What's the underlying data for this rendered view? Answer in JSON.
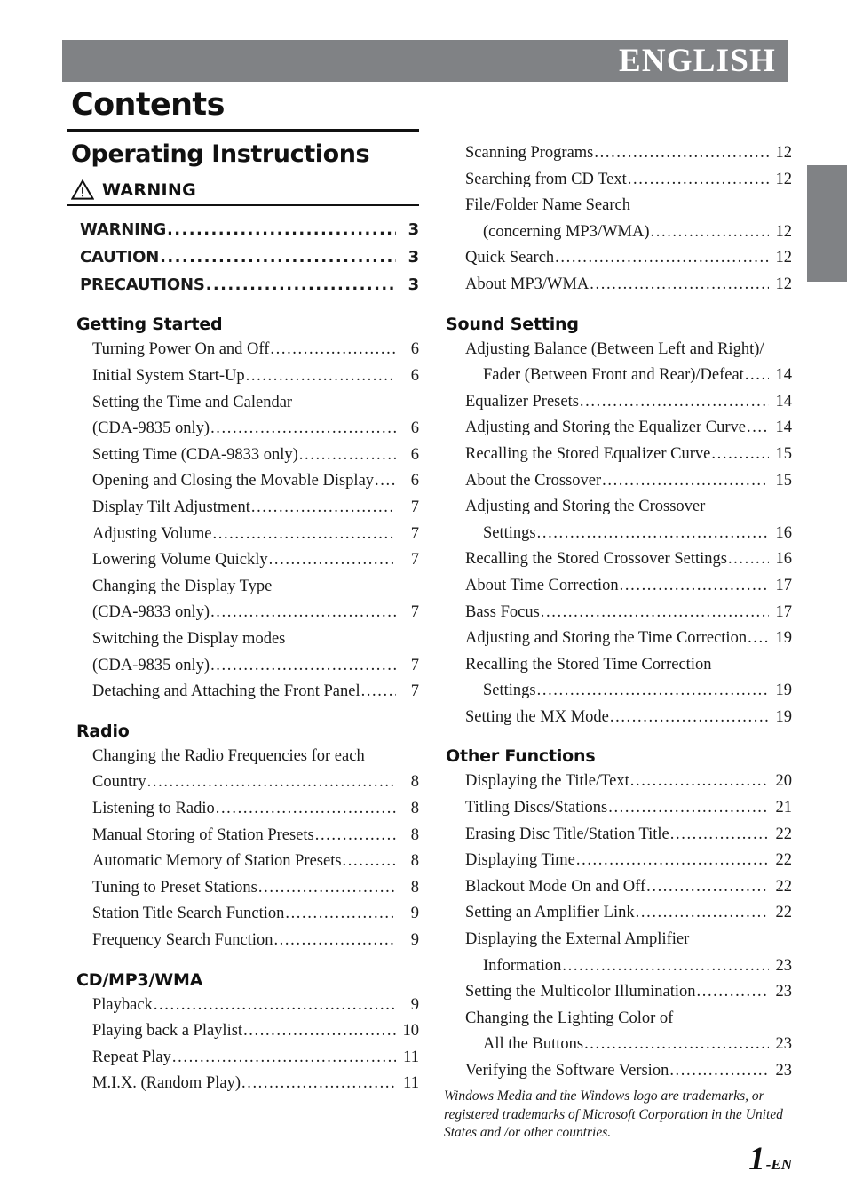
{
  "banner": {
    "language_label": "ENGLISH",
    "background_color": "#808285",
    "text_color": "#ffffff"
  },
  "side_tab": {
    "color": "#808285"
  },
  "header": {
    "page_title": "Contents",
    "document_subtitle": "Operating Instructions",
    "warning_heading": "WARNING",
    "warning_icon": "warning-triangle-icon"
  },
  "left_column": {
    "warning_block": {
      "entries": [
        {
          "label": "WARNING",
          "page": "3"
        },
        {
          "label": "CAUTION",
          "page": "3"
        },
        {
          "label": "PRECAUTIONS",
          "page": "3"
        }
      ]
    },
    "sections": [
      {
        "heading": "Getting Started",
        "entries": [
          {
            "label": "Turning Power On and Off",
            "page": "6"
          },
          {
            "label": "Initial System Start-Up",
            "page": "6"
          },
          {
            "label": "Setting the Time and Calendar",
            "page": "",
            "wrap": true
          },
          {
            "label": "(CDA-9835 only)",
            "page": "6",
            "cont": true
          },
          {
            "label": "Setting Time (CDA-9833 only)",
            "page": "6"
          },
          {
            "label": "Opening and Closing the Movable Display",
            "page": "6"
          },
          {
            "label": "Display Tilt Adjustment",
            "page": "7"
          },
          {
            "label": "Adjusting Volume",
            "page": "7"
          },
          {
            "label": "Lowering Volume Quickly",
            "page": "7"
          },
          {
            "label": "Changing the Display Type",
            "page": "",
            "wrap": true
          },
          {
            "label": "(CDA-9833 only)",
            "page": "7",
            "cont": true
          },
          {
            "label": "Switching the Display modes",
            "page": "",
            "wrap": true
          },
          {
            "label": "(CDA-9835 only)",
            "page": "7",
            "cont": true
          },
          {
            "label": "Detaching and Attaching the Front Panel",
            "page": "7"
          }
        ]
      },
      {
        "heading": "Radio",
        "entries": [
          {
            "label": "Changing the Radio Frequencies for each",
            "page": "",
            "wrap": true
          },
          {
            "label": "Country",
            "page": "8",
            "cont": true
          },
          {
            "label": "Listening to Radio",
            "page": "8"
          },
          {
            "label": "Manual Storing of Station Presets",
            "page": "8"
          },
          {
            "label": "Automatic Memory of Station Presets",
            "page": "8"
          },
          {
            "label": "Tuning to Preset Stations",
            "page": "8"
          },
          {
            "label": "Station Title Search Function",
            "page": "9"
          },
          {
            "label": "Frequency Search Function",
            "page": "9"
          }
        ]
      },
      {
        "heading": "CD/MP3/WMA",
        "entries": [
          {
            "label": "Playback",
            "page": "9"
          },
          {
            "label": "Playing back a Playlist",
            "page": "10"
          },
          {
            "label": "Repeat Play",
            "page": "11"
          },
          {
            "label": "M.I.X. (Random Play)",
            "page": "11"
          }
        ]
      }
    ]
  },
  "right_column": {
    "continued_entries": [
      {
        "label": "Scanning Programs",
        "page": "12"
      },
      {
        "label": "Searching from CD Text",
        "page": "12"
      },
      {
        "label": "File/Folder Name Search",
        "page": "",
        "wrap": true
      },
      {
        "label": "(concerning MP3/WMA)",
        "page": "12",
        "cont": true
      },
      {
        "label": "Quick Search",
        "page": "12"
      },
      {
        "label": "About MP3/WMA",
        "page": "12"
      }
    ],
    "sections": [
      {
        "heading": "Sound Setting",
        "entries": [
          {
            "label": "Adjusting Balance (Between Left and Right)/",
            "page": "",
            "wrap": true
          },
          {
            "label": "Fader (Between Front and Rear)/Defeat",
            "page": "14",
            "cont": true
          },
          {
            "label": "Equalizer Presets",
            "page": "14"
          },
          {
            "label": "Adjusting and Storing the Equalizer Curve",
            "page": "14"
          },
          {
            "label": "Recalling the Stored Equalizer Curve",
            "page": "15"
          },
          {
            "label": "About the Crossover",
            "page": "15"
          },
          {
            "label": "Adjusting and Storing the Crossover",
            "page": "",
            "wrap": true
          },
          {
            "label": "Settings",
            "page": "16",
            "cont": true
          },
          {
            "label": "Recalling the Stored Crossover Settings",
            "page": "16"
          },
          {
            "label": "About Time Correction",
            "page": "17"
          },
          {
            "label": "Bass Focus",
            "page": "17"
          },
          {
            "label": "Adjusting and Storing the Time Correction",
            "page": "19"
          },
          {
            "label": "Recalling the Stored Time Correction",
            "page": "",
            "wrap": true
          },
          {
            "label": "Settings",
            "page": "19",
            "cont": true
          },
          {
            "label": "Setting the MX Mode",
            "page": "19"
          }
        ]
      },
      {
        "heading": "Other Functions",
        "entries": [
          {
            "label": "Displaying the Title/Text",
            "page": "20"
          },
          {
            "label": "Titling Discs/Stations",
            "page": "21"
          },
          {
            "label": "Erasing Disc Title/Station Title",
            "page": "22"
          },
          {
            "label": "Displaying Time",
            "page": "22"
          },
          {
            "label": "Blackout Mode On and Off",
            "page": "22"
          },
          {
            "label": "Setting an Amplifier Link",
            "page": "22"
          },
          {
            "label": "Displaying the External Amplifier",
            "page": "",
            "wrap": true
          },
          {
            "label": "Information",
            "page": "23",
            "cont": true
          },
          {
            "label": "Setting the Multicolor Illumination",
            "page": "23"
          },
          {
            "label": "Changing the Lighting Color of",
            "page": "",
            "wrap": true
          },
          {
            "label": "All the Buttons",
            "page": "23",
            "cont": true
          },
          {
            "label": "Verifying the Software Version",
            "page": "23"
          }
        ]
      }
    ]
  },
  "footnote": "Windows Media and the Windows logo are trademarks, or registered trademarks of Microsoft Corporation in the United States and /or other countries.",
  "folio": {
    "number": "1",
    "suffix": "-EN"
  }
}
